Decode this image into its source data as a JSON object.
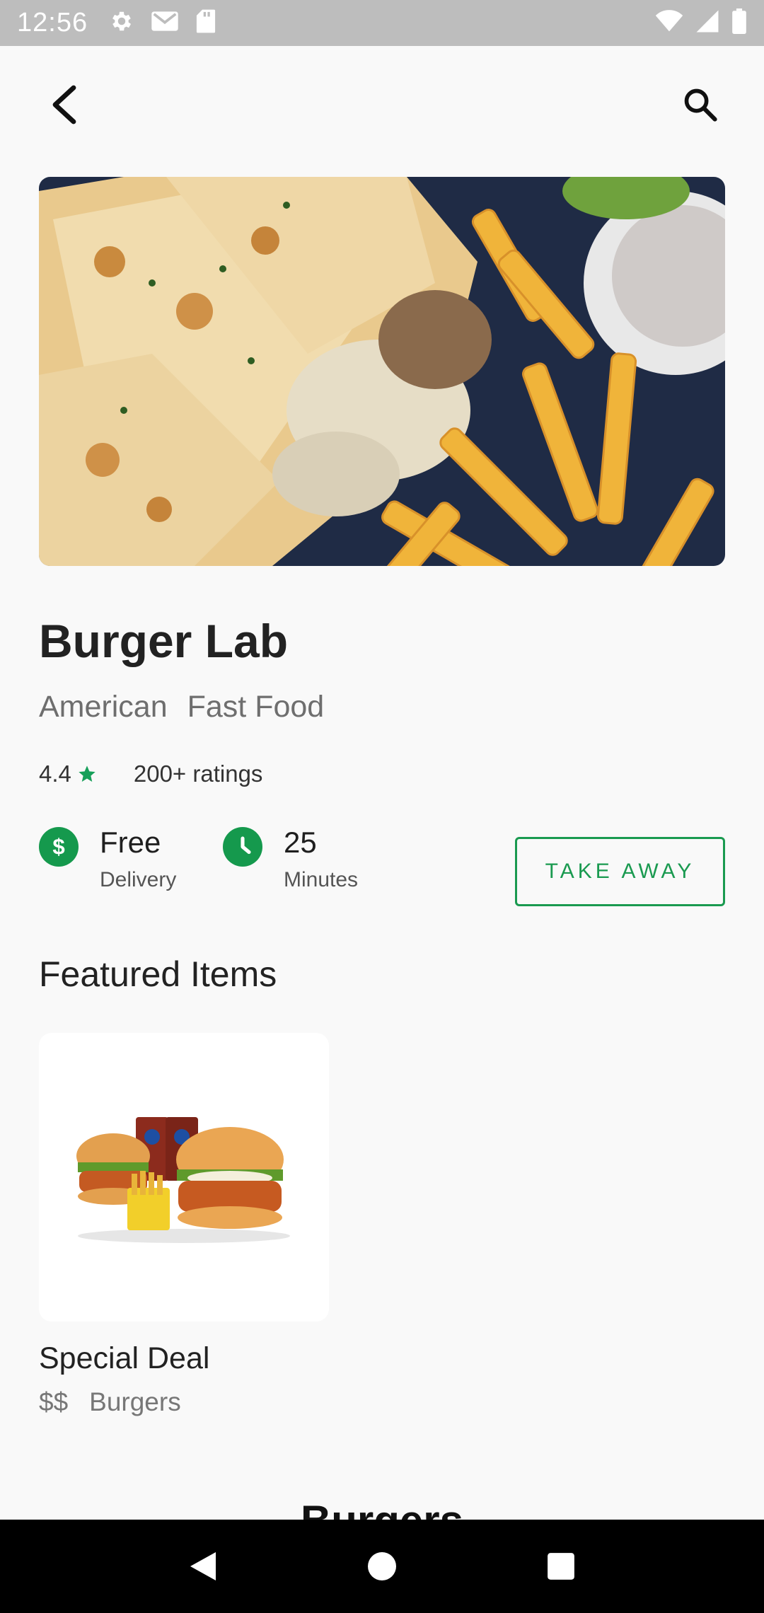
{
  "status_bar": {
    "time": "12:56",
    "left_icons": [
      "gear-icon",
      "mail-icon",
      "sd-card-icon"
    ],
    "right_icons": [
      "wifi-icon",
      "signal-icon",
      "battery-icon"
    ]
  },
  "top_bar": {
    "back_icon": "back-arrow-icon",
    "search_icon": "search-icon"
  },
  "restaurant": {
    "name": "Burger Lab",
    "cuisines": [
      "American",
      "Fast Food"
    ],
    "rating": "4.4",
    "ratings_count": "200+ ratings",
    "delivery": {
      "main": "Free",
      "sub": "Delivery"
    },
    "time": {
      "main": "25",
      "sub": "Minutes"
    },
    "takeaway_label": "TAKE AWAY"
  },
  "featured": {
    "section_title": "Featured Items",
    "items": [
      {
        "title": "Special Deal",
        "price": "$$",
        "category": "Burgers"
      }
    ]
  },
  "next_section_title": "Burgers",
  "colors": {
    "accent": "#1a9a50",
    "status_bar": "#bdbdbd",
    "background": "#f9f9f9",
    "nav_bar": "#000000"
  }
}
